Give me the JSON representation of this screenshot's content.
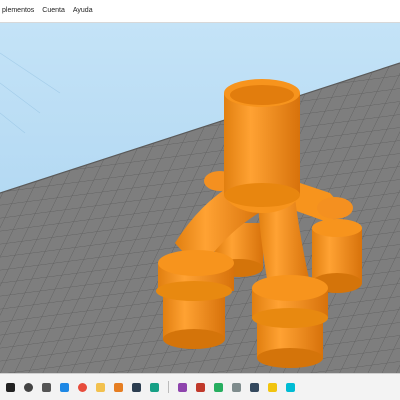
{
  "menu": {
    "items": [
      {
        "label": "plementos"
      },
      {
        "label": "Cuenta"
      },
      {
        "label": "Ayuda"
      }
    ]
  },
  "viewport": {
    "background_color": "#a9d4f2",
    "bed_color": "#7e7e7e",
    "grid_color": "#5f5f5f",
    "model_color": "#f7941d",
    "model_shade_color": "#d4740a"
  },
  "taskbar": {
    "icons": [
      {
        "name": "windows-start-icon",
        "color": "#222222"
      },
      {
        "name": "search-icon",
        "color": "#444444"
      },
      {
        "name": "task-view-icon",
        "color": "#555555"
      },
      {
        "name": "app-icon-blue",
        "color": "#1e88e5"
      },
      {
        "name": "chrome-icon",
        "color": "#e74c3c"
      },
      {
        "name": "folder-icon",
        "color": "#f2c14e"
      },
      {
        "name": "app-icon-orange",
        "color": "#e67e22"
      },
      {
        "name": "app-icon-dark",
        "color": "#2c3e50"
      },
      {
        "name": "app-icon-teal",
        "color": "#16a085"
      },
      {
        "name": "separator",
        "color": ""
      },
      {
        "name": "app-icon-purple",
        "color": "#8e44ad"
      },
      {
        "name": "app-icon-red",
        "color": "#c0392b"
      },
      {
        "name": "app-icon-green",
        "color": "#27ae60"
      },
      {
        "name": "app-icon-gray",
        "color": "#7f8c8d"
      },
      {
        "name": "app-icon-navy",
        "color": "#34495e"
      },
      {
        "name": "app-icon-yellow",
        "color": "#f1c40f"
      },
      {
        "name": "app-icon-cyan",
        "color": "#00bcd4"
      }
    ]
  }
}
